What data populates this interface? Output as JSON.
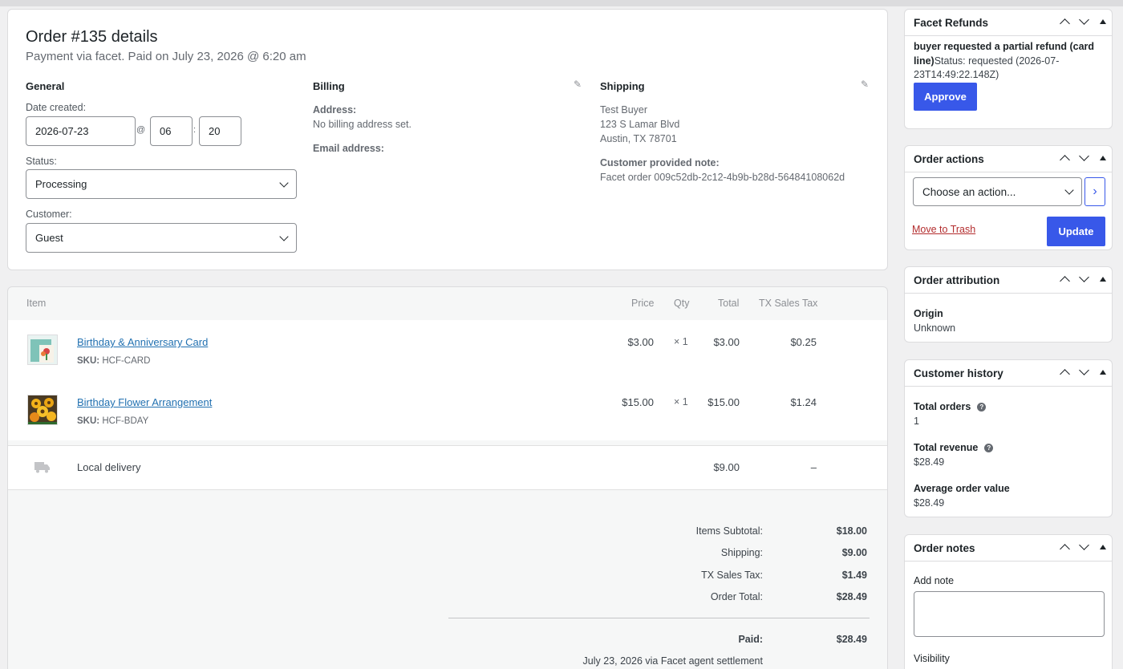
{
  "order": {
    "title": "Order #135 details",
    "subtitle": "Payment via facet. Paid on July 23, 2026 @ 6:20 am",
    "general": {
      "heading": "General",
      "date_label": "Date created:",
      "date": "2026-07-23",
      "at": "@",
      "hour": "06",
      "colon": ":",
      "minute": "20",
      "status_label": "Status:",
      "status": "Processing",
      "customer_label": "Customer:",
      "customer": "Guest"
    },
    "billing": {
      "heading": "Billing",
      "address_label": "Address:",
      "address": "No billing address set.",
      "email_label": "Email address:"
    },
    "shipping": {
      "heading": "Shipping",
      "name": "Test Buyer",
      "street": "123 S Lamar Blvd",
      "city": "Austin, TX 78701",
      "note_label": "Customer provided note:",
      "note": "Facet order 009c52db-2c12-4b9b-b28d-56484108062d"
    }
  },
  "items": {
    "headers": {
      "item": "Item",
      "price": "Price",
      "qty": "Qty",
      "total": "Total",
      "tax": "TX Sales Tax"
    },
    "rows": [
      {
        "name": "Birthday & Anniversary Card",
        "sku_label": "SKU:",
        "sku": "HCF-CARD",
        "price": "$3.00",
        "qty": "× 1",
        "total": "$3.00",
        "tax": "$0.25"
      },
      {
        "name": "Birthday Flower Arrangement",
        "sku_label": "SKU:",
        "sku": "HCF-BDAY",
        "price": "$15.00",
        "qty": "× 1",
        "total": "$15.00",
        "tax": "$1.24"
      }
    ],
    "shipping_line": {
      "name": "Local delivery",
      "total": "$9.00",
      "tax": "–"
    },
    "totals": {
      "subtotal_label": "Items Subtotal:",
      "subtotal": "$18.00",
      "shipping_label": "Shipping:",
      "shipping": "$9.00",
      "tax_label": "TX Sales Tax:",
      "tax": "$1.49",
      "order_total_label": "Order Total:",
      "order_total": "$28.49",
      "paid_label": "Paid:",
      "paid": "$28.49",
      "paid_note": "July 23, 2026 via Facet agent settlement"
    }
  },
  "sidebar": {
    "refunds": {
      "title": "Facet Refunds",
      "reason": "buyer requested a partial refund (card line)",
      "status": "Status: requested (2026-07-23T14:49:22.148Z)",
      "approve": "Approve"
    },
    "actions": {
      "title": "Order actions",
      "select": "Choose an action...",
      "go": "›",
      "trash": "Move to Trash",
      "update": "Update"
    },
    "attribution": {
      "title": "Order attribution",
      "origin_label": "Origin",
      "origin": "Unknown"
    },
    "history": {
      "title": "Customer history",
      "orders_label": "Total orders",
      "orders": "1",
      "revenue_label": "Total revenue",
      "revenue": "$28.49",
      "aov_label": "Average order value",
      "aov": "$28.49",
      "help": "?"
    },
    "notes": {
      "title": "Order notes",
      "add_label": "Add note",
      "visibility_label": "Visibility"
    }
  },
  "colors": {
    "accent": "#3858e9",
    "link": "#2271b1",
    "danger": "#b32d2e"
  },
  "icons": {
    "edit": "pencil-icon",
    "shipping": "truck-icon",
    "move_up": "chevron-up-icon",
    "move_down": "chevron-down-icon",
    "toggle": "triangle-up-icon"
  }
}
